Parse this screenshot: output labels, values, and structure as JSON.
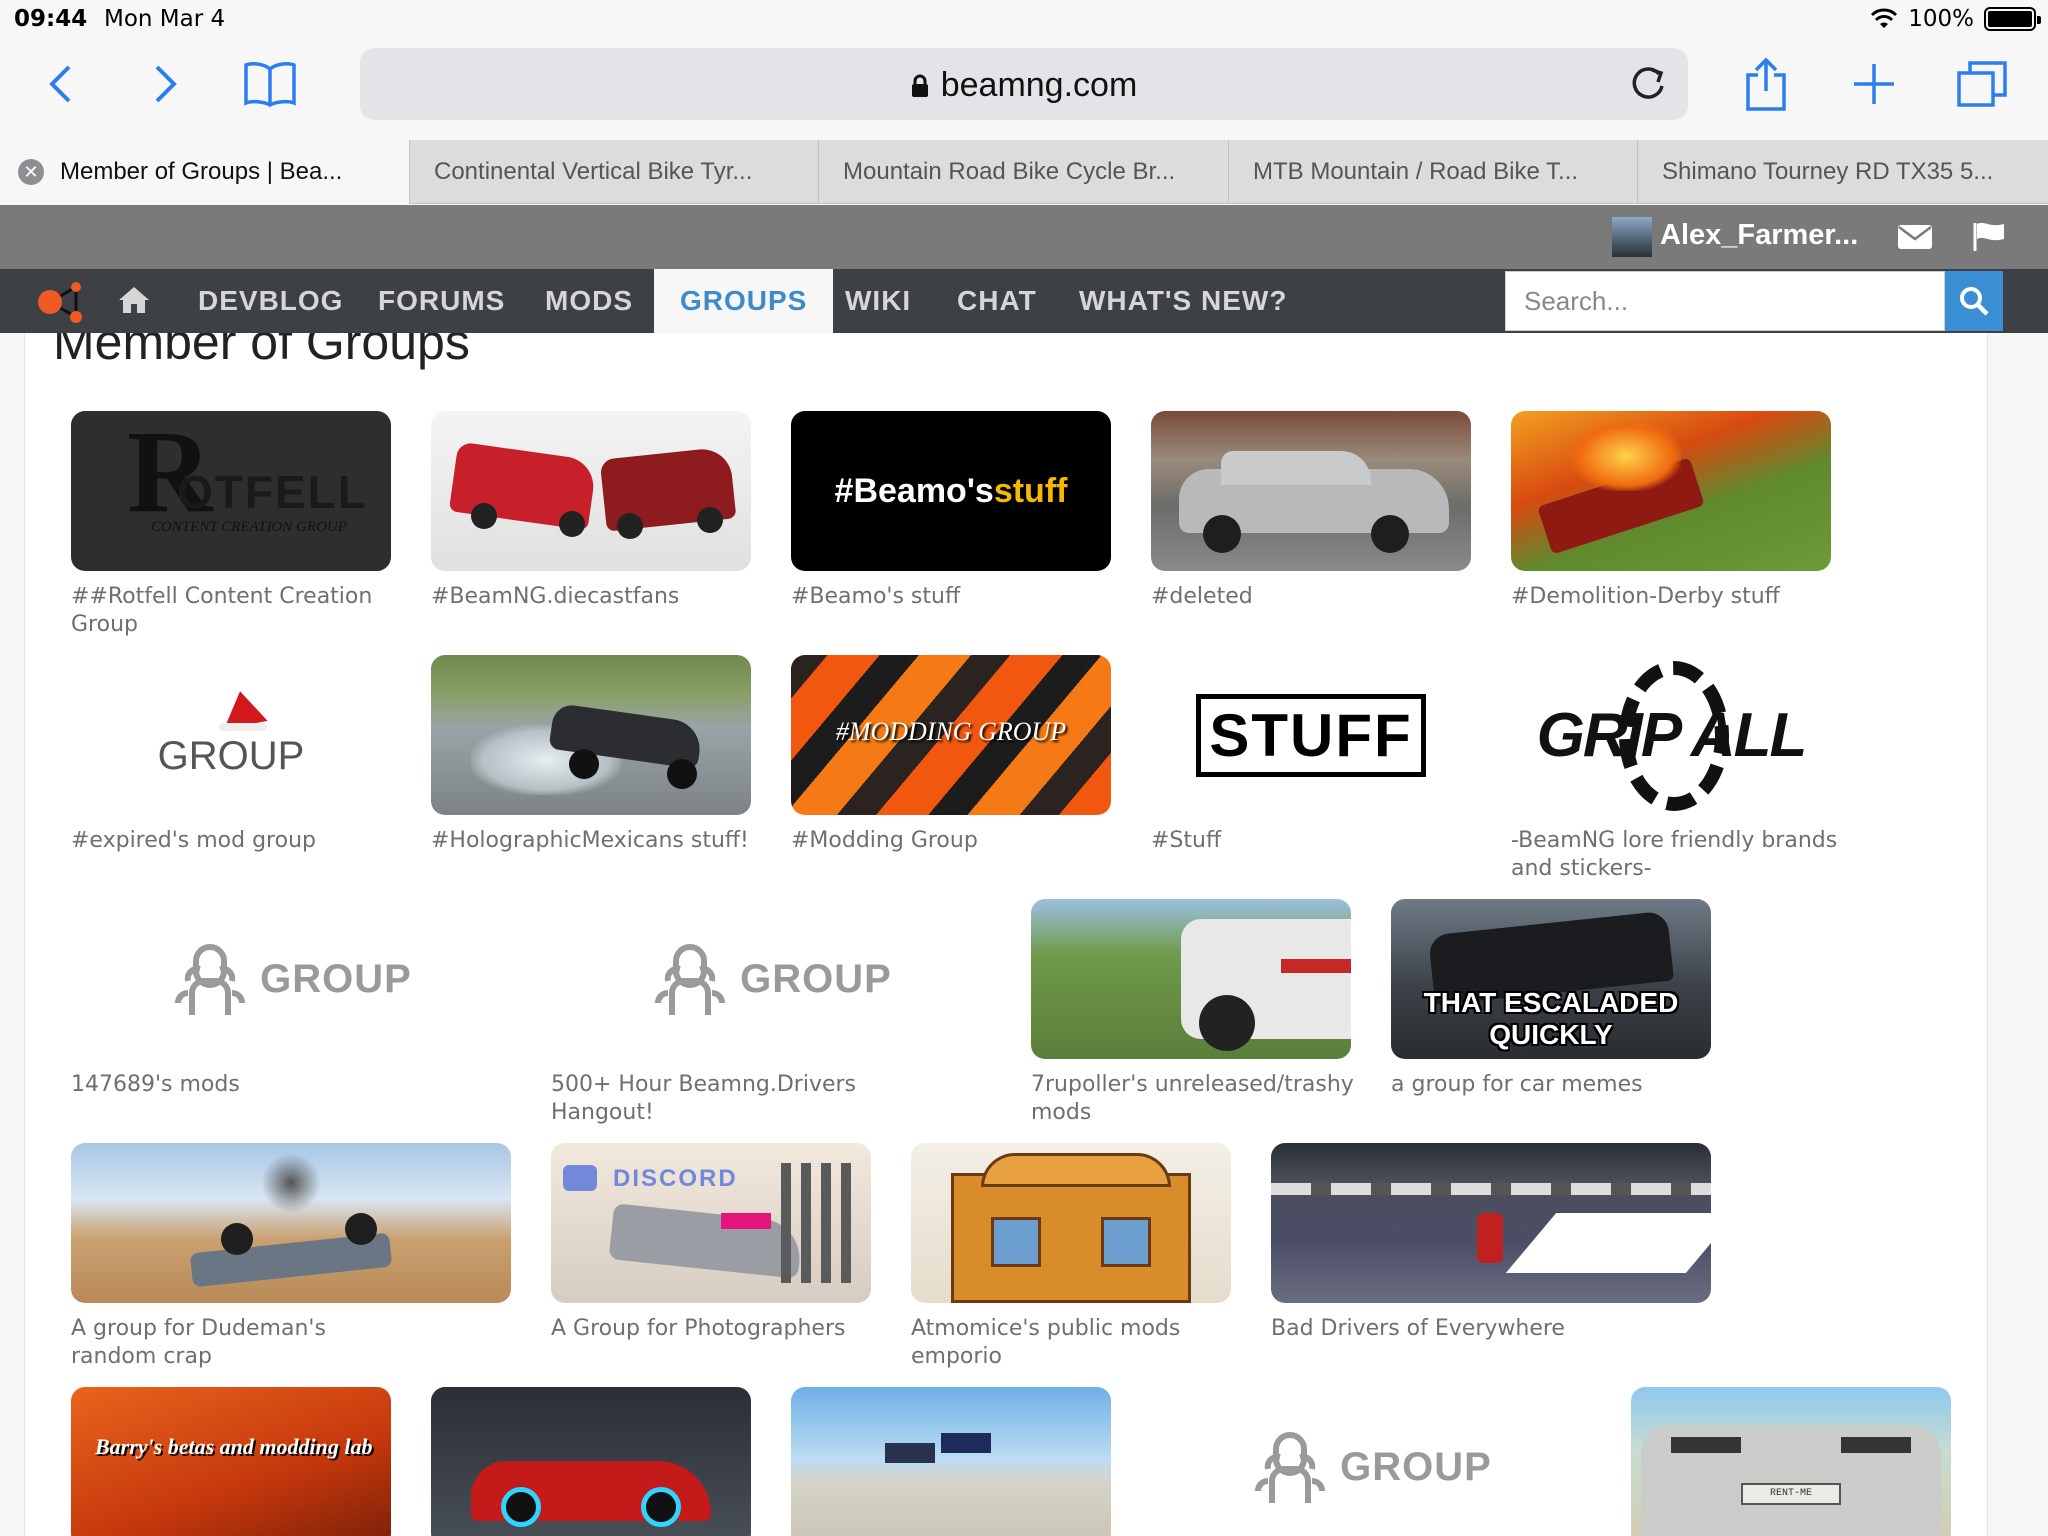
{
  "status": {
    "time": "09:44",
    "date": "Mon Mar 4",
    "battery": "100%"
  },
  "browser": {
    "url": "beamng.com",
    "tabs": [
      {
        "label": "Member of Groups | Bea..."
      },
      {
        "label": "Continental Vertical Bike Tyr..."
      },
      {
        "label": "Mountain Road Bike Cycle Br..."
      },
      {
        "label": "MTB Mountain / Road Bike T..."
      },
      {
        "label": "Shimano Tourney RD TX35 5..."
      }
    ]
  },
  "user": {
    "name": "Alex_Farmer..."
  },
  "nav": {
    "items": [
      "DEVBLOG",
      "FORUMS",
      "MODS",
      "GROUPS",
      "WIKI",
      "CHAT",
      "WHAT'S NEW?"
    ],
    "search_placeholder": "Search..."
  },
  "page": {
    "title": "Member of Groups"
  },
  "groups": {
    "row1": [
      {
        "label": "##Rotfell Content Creation Group",
        "logo_text": "OTFELL",
        "logo_sub": "CONTENT CREATION GROUP"
      },
      {
        "label": "#BeamNG.diecastfans"
      },
      {
        "label": "#Beamo's stuff",
        "logo_text_a": "#Beamo's ",
        "logo_text_b": "stuff"
      },
      {
        "label": "#deleted"
      },
      {
        "label": "#Demolition-Derby stuff"
      }
    ],
    "row2": [
      {
        "label": "#expired's mod group",
        "logo_text": "GROUP"
      },
      {
        "label": "#HolographicMexicans stuff!"
      },
      {
        "label": "#Modding Group",
        "logo_text": "#MODDING GROUP"
      },
      {
        "label": "#Stuff",
        "logo_text": "STUFF"
      },
      {
        "label": "-BeamNG lore friendly brands and stickers-",
        "logo_text": "GRIP ALL"
      }
    ],
    "row3": [
      {
        "label": "147689's mods",
        "logo_text": "GROUP"
      },
      {
        "label": "500+ Hour Beamng.Drivers Hangout!",
        "logo_text": "GROUP"
      },
      {
        "label": "7rupoller's unreleased/trashy mods"
      },
      {
        "label": "a group for car memes",
        "logo_text": "THAT ESCALADED QUICKLY"
      }
    ],
    "row4": [
      {
        "label": "A group for Dudeman's random crap"
      },
      {
        "label": "A Group for Photographers",
        "logo_text": "DISCORD"
      },
      {
        "label": "Atmomice's public mods emporio"
      },
      {
        "label": "Bad Drivers of Everywhere"
      }
    ],
    "row5": [
      {
        "label": "",
        "logo_text": "Barry's betas and modding lab"
      },
      {
        "label": ""
      },
      {
        "label": ""
      },
      {
        "label": "",
        "logo_text": "GROUP"
      },
      {
        "label": "",
        "logo_text": "RENT-ME"
      }
    ]
  },
  "colors": {
    "accent": "#3d8bc8",
    "nav_bg": "#3d4044",
    "userbar_bg": "#7a7a7a",
    "search_btn": "#3a8fd3"
  }
}
